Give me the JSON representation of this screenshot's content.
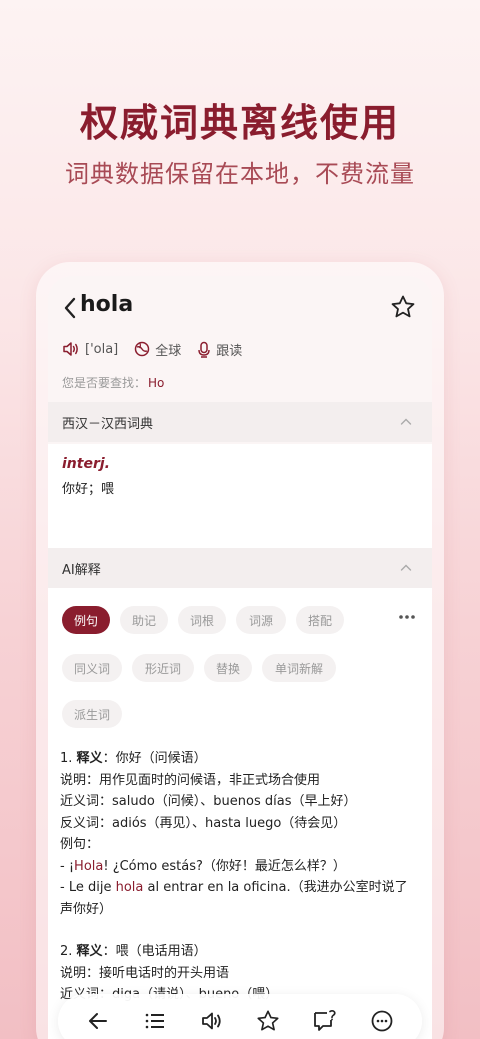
{
  "promo": {
    "headline": "权威词典离线使用",
    "subline": "词典数据保留在本地，不费流量"
  },
  "entry": {
    "word": "hola",
    "phonetic": "['ola]",
    "region_label": "全球",
    "follow_read_label": "跟读",
    "suggest_prefix": "您是否要查找：",
    "suggest_word": "Ho"
  },
  "dictionary": {
    "title": "西汉－汉西词典",
    "pos": "interj.",
    "meaning": "你好；喂"
  },
  "ai": {
    "title": "AI解释",
    "tabs": [
      "例句",
      "助记",
      "词根",
      "词源",
      "搭配",
      "同义词",
      "形近词",
      "替换",
      "单词新解",
      "派生词"
    ],
    "active_tab": "例句",
    "sense1": {
      "num": "1. ",
      "label": "释义",
      "text": "：你好（问候语）",
      "desc": "说明：用作见面时的问候语，非正式场合使用",
      "syn": "近义词：saludo（问候）、buenos días（早上好）",
      "ant": "反义词：adiós（再见）、hasta luego（待会见）",
      "ex_label": "例句：",
      "ex1_pre": "- ¡",
      "ex1_hl": "Hola",
      "ex1_post": "! ¿Cómo estás?（你好！最近怎么样？）",
      "ex2_pre": "- Le dije ",
      "ex2_hl": "hola",
      "ex2_post": " al entrar en la oficina.（我进办公室时说了声你好）"
    },
    "sense2": {
      "num": "2. ",
      "label": "释义",
      "text": "：喂（电话用语）",
      "desc": "说明：接听电话时的开头用语",
      "syn": "近义词：diga（请说）、bueno（喂）"
    }
  },
  "bottom_bar": [
    "back-icon",
    "list-icon",
    "speaker-icon",
    "star-icon",
    "ask-icon",
    "more-icon"
  ],
  "colors": {
    "accent": "#8a1d2e",
    "subline": "#a84a55"
  }
}
